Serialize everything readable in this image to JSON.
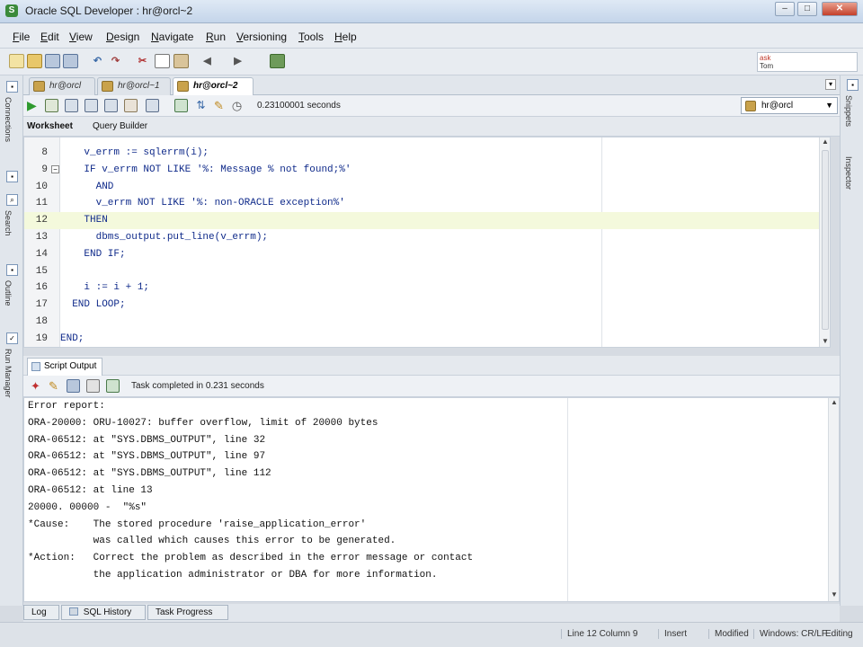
{
  "window": {
    "title": "Oracle SQL Developer : hr@orcl~2",
    "minimize_label": "–",
    "maximize_label": "□",
    "close_label": "✕"
  },
  "menu": {
    "items": [
      "File",
      "Edit",
      "View",
      "Design",
      "Navigate",
      "Run",
      "Versioning",
      "Tools",
      "Help"
    ]
  },
  "ask_box": {
    "label": "ask",
    "sub": "Tom"
  },
  "side_left": {
    "connections": "Connections",
    "search": "Search",
    "outline": "Outline",
    "run_manager": "Run Manager"
  },
  "side_right": {
    "snippets": "Snippets",
    "inspector": "Inspector"
  },
  "doc_tabs": [
    {
      "label": "hr@orcl"
    },
    {
      "label": "hr@orcl~1"
    },
    {
      "label": "hr@orcl~2"
    }
  ],
  "worksheet": {
    "elapsed": "0.23100001 seconds",
    "connection": "hr@orcl",
    "tabs": [
      "Worksheet",
      "Query Builder"
    ]
  },
  "editor": {
    "lines": [
      {
        "n": "8",
        "code": "    v_errm := sqlerrm(i);"
      },
      {
        "n": "9",
        "code": "    IF v_errm NOT LIKE '%: Message % not found;%'"
      },
      {
        "n": "10",
        "code": "      AND"
      },
      {
        "n": "11",
        "code": "      v_errm NOT LIKE '%: non-ORACLE exception%'"
      },
      {
        "n": "12",
        "code": "    THEN"
      },
      {
        "n": "13",
        "code": "      dbms_output.put_line(v_errm);"
      },
      {
        "n": "14",
        "code": "    END IF;"
      },
      {
        "n": "15",
        "code": ""
      },
      {
        "n": "16",
        "code": "    i := i + 1;"
      },
      {
        "n": "17",
        "code": "  END LOOP;"
      },
      {
        "n": "18",
        "code": ""
      },
      {
        "n": "19",
        "code": "END;"
      }
    ],
    "current_line": "12"
  },
  "output": {
    "tab_label": "Script Output",
    "status": "Task completed in 0.231 seconds",
    "lines": [
      "Error report:",
      "ORA-20000: ORU-10027: buffer overflow, limit of 20000 bytes",
      "ORA-06512: at \"SYS.DBMS_OUTPUT\", line 32",
      "ORA-06512: at \"SYS.DBMS_OUTPUT\", line 97",
      "ORA-06512: at \"SYS.DBMS_OUTPUT\", line 112",
      "ORA-06512: at line 13",
      "20000. 00000 -  \"%s\"",
      "*Cause:    The stored procedure 'raise_application_error'",
      "           was called which causes this error to be generated.",
      "*Action:   Correct the problem as described in the error message or contact",
      "           the application administrator or DBA for more information."
    ]
  },
  "bottom_tabs": [
    "Log",
    "SQL History",
    "Task Progress"
  ],
  "status_bar": {
    "position": "Line 12 Column 9",
    "mode": "Insert",
    "modified": "Modified",
    "line_endings": "Windows: CR/LF",
    "editing": "Editing"
  },
  "colors": {
    "keyword": "#0a2a9c",
    "current_line_bg": "#f4f9dc",
    "run_green": "#2e9a2e"
  }
}
